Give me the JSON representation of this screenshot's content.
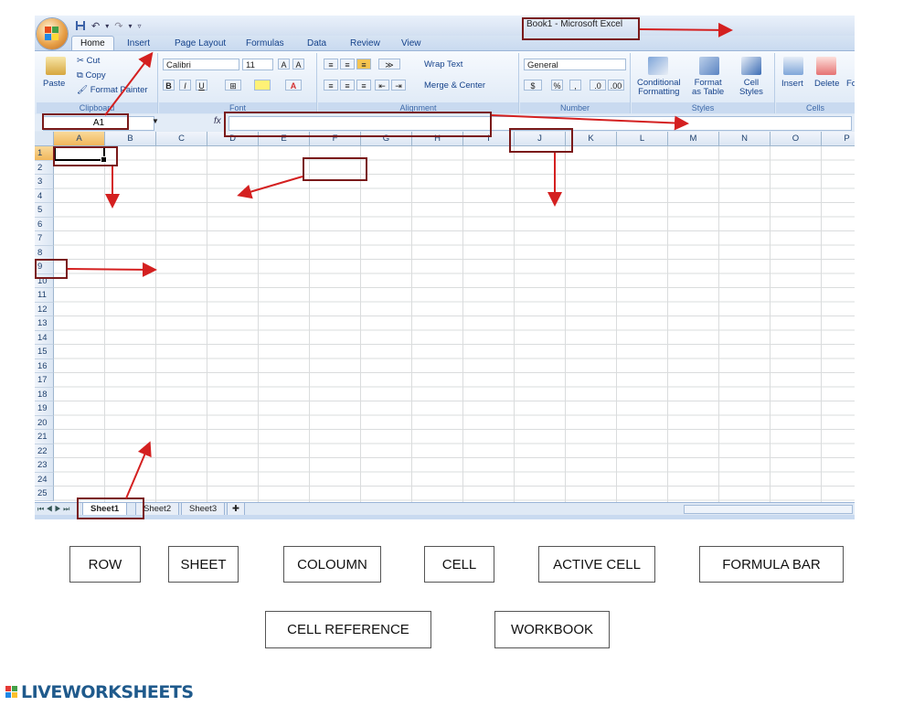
{
  "window": {
    "title": "Book1 - Microsoft Excel"
  },
  "tabs": [
    "Home",
    "Insert",
    "Page Layout",
    "Formulas",
    "Data",
    "Review",
    "View"
  ],
  "ribbon": {
    "clipboard": {
      "label": "Clipboard",
      "paste": "Paste",
      "cut": "Cut",
      "copy": "Copy",
      "format_painter": "Format Painter"
    },
    "font": {
      "label": "Font",
      "font_name": "Calibri",
      "font_size": "11",
      "bold": "B",
      "italic": "I",
      "underline": "U"
    },
    "alignment": {
      "label": "Alignment",
      "wrap_text": "Wrap Text",
      "merge_center": "Merge & Center"
    },
    "number": {
      "label": "Number",
      "format": "General",
      "percent": "%",
      "comma": ","
    },
    "styles": {
      "label": "Styles",
      "conditional_1": "Conditional",
      "conditional_2": "Formatting",
      "format_table_1": "Format",
      "format_table_2": "as Table",
      "cell_styles_1": "Cell",
      "cell_styles_2": "Styles"
    },
    "cells": {
      "label": "Cells",
      "insert": "Insert",
      "delete": "Delete",
      "format": "Fo"
    }
  },
  "formula_bar": {
    "name_box": "A1",
    "fx": "fx"
  },
  "columns": [
    "A",
    "B",
    "C",
    "D",
    "E",
    "F",
    "G",
    "H",
    "I",
    "J",
    "K",
    "L",
    "M",
    "N",
    "O",
    "P"
  ],
  "rows": [
    "1",
    "2",
    "3",
    "4",
    "5",
    "6",
    "7",
    "8",
    "9",
    "10",
    "11",
    "12",
    "13",
    "14",
    "15",
    "16",
    "17",
    "18",
    "19",
    "20",
    "21",
    "22",
    "23",
    "24",
    "25"
  ],
  "sheets": [
    "Sheet1",
    "Sheet2",
    "Sheet3"
  ],
  "answers": [
    "ROW",
    "SHEET",
    "COLOUMN",
    "CELL",
    "ACTIVE CELL",
    "FORMULA BAR",
    "CELL REFERENCE",
    "WORKBOOK"
  ],
  "brand": "LIVEWORKSHEETS",
  "colors": {
    "highlight": "#7a1a1a",
    "arrow": "#d42020",
    "brand": "#1f5a8c"
  },
  "icons": [
    "office-button-icon",
    "save-icon",
    "undo-icon",
    "redo-icon",
    "paste-icon",
    "cut-icon",
    "copy-icon",
    "format-painter-icon",
    "sheet-nav-icon",
    "insert-sheet-icon"
  ]
}
